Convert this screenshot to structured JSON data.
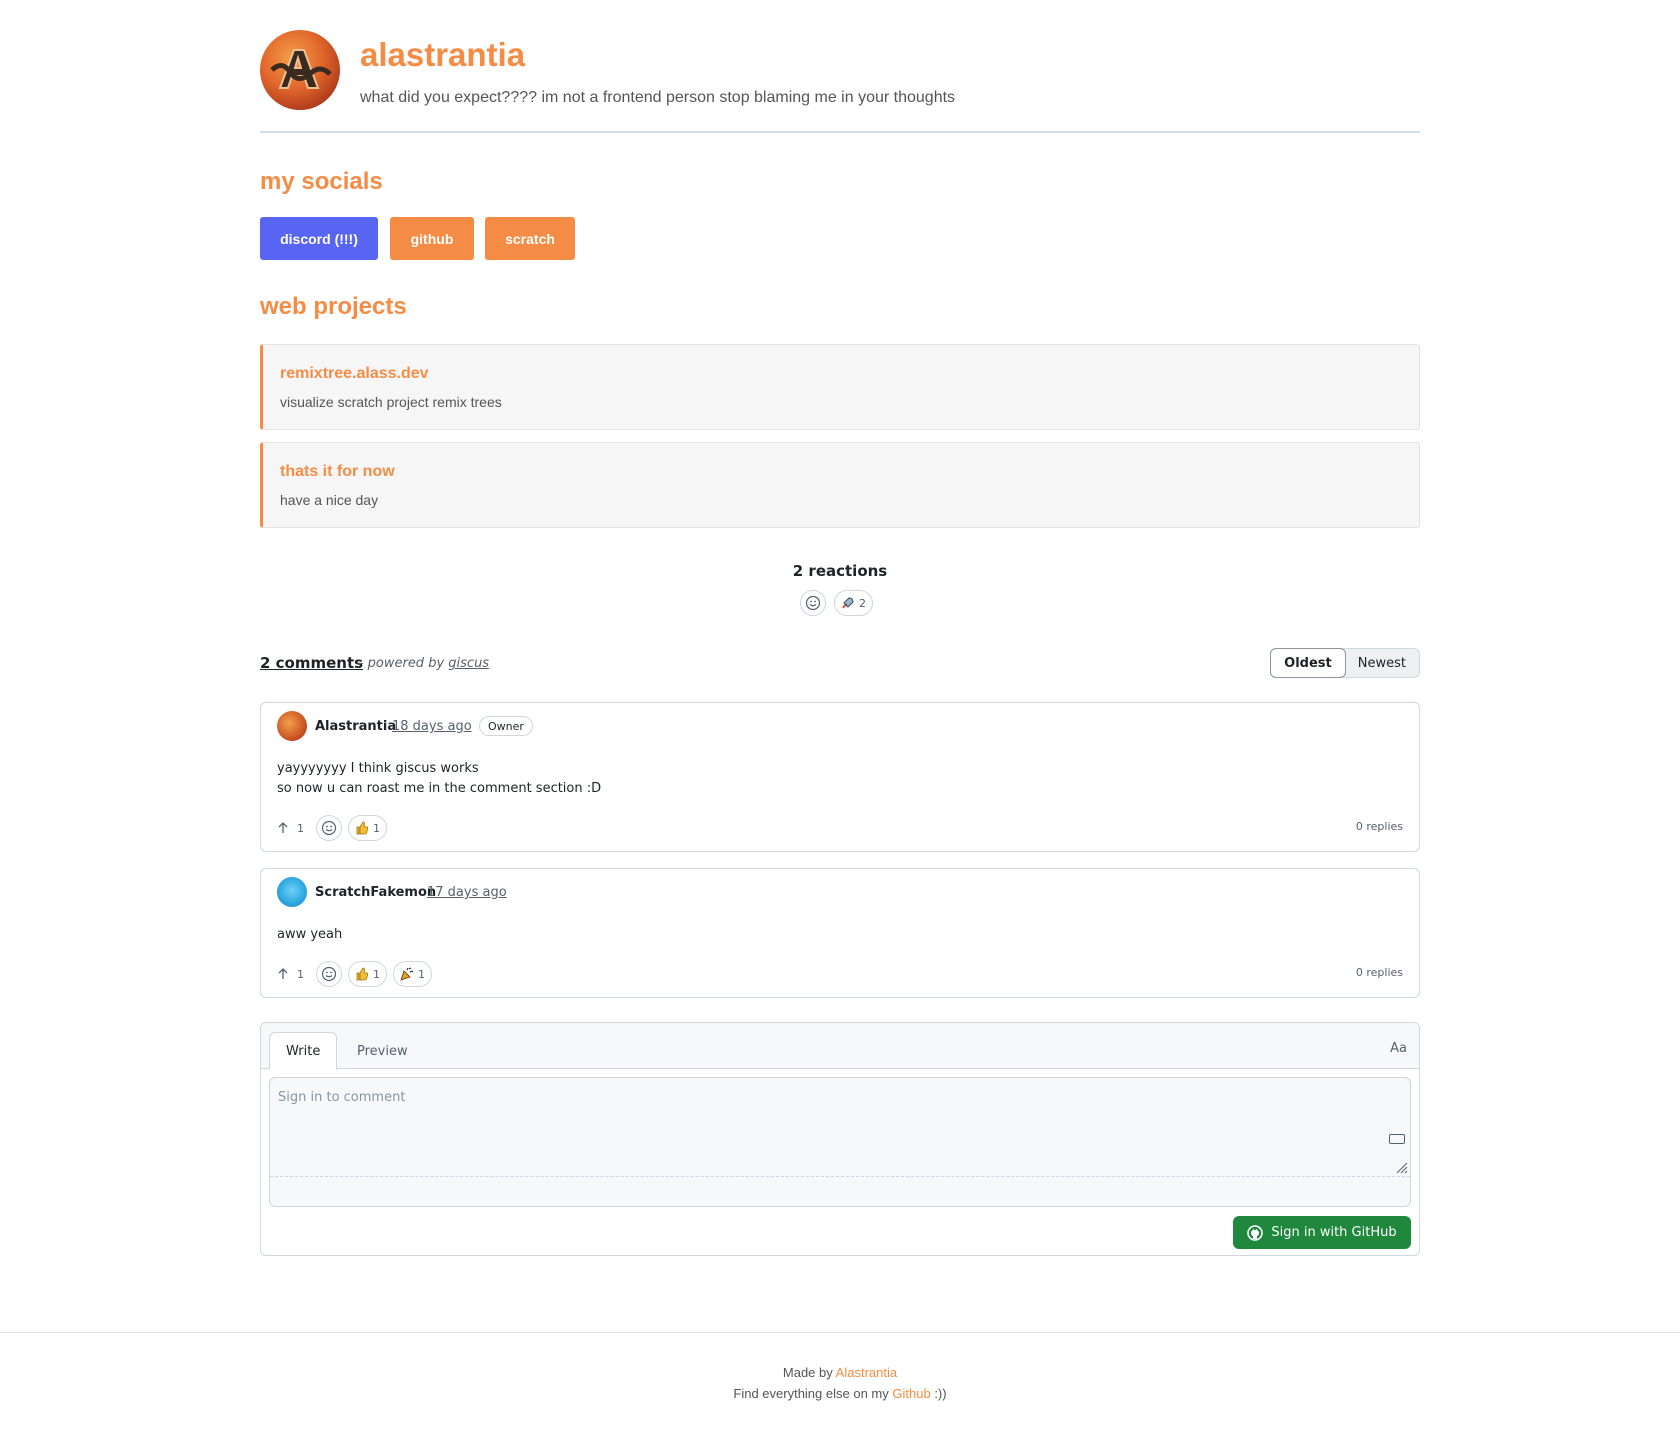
{
  "profile": {
    "name": "alastrantia",
    "tagline": "what did you expect???? im not a frontend person stop blaming me in your thoughts"
  },
  "socials": {
    "heading": "my socials",
    "buttons": [
      "discord (!!!)",
      "github",
      "scratch"
    ],
    "discord_color": "#5865f2",
    "accent_color": "#f58c45"
  },
  "projects": {
    "heading": "web projects",
    "items": [
      {
        "title": "remixtree.alass.dev",
        "desc": "visualize scratch project remix trees"
      },
      {
        "title": "thats it for now",
        "desc": "have a nice day"
      }
    ]
  },
  "giscus": {
    "reactions_title": "2 reactions",
    "rocket_count": "2",
    "comments_count": "2 comments",
    "powered_prefix": "– powered by",
    "powered_link": "giscus",
    "sort": [
      "Oldest",
      "Newest"
    ],
    "comments": [
      {
        "author": "Alastrantia",
        "time": "18 days ago",
        "badge": "Owner",
        "lines": [
          "yayyyyyyy I think giscus works",
          "so now u can roast me in the comment section :D"
        ],
        "upvotes": "1",
        "thumbs": "1",
        "replies": "0 replies"
      },
      {
        "author": "ScratchFakemon",
        "time": "17 days ago",
        "lines": [
          "aww yeah"
        ],
        "upvotes": "1",
        "thumbs": "1",
        "other": "1",
        "replies": "0 replies"
      }
    ],
    "editor": {
      "tab_write": "Write",
      "tab_preview": "Preview",
      "aa": "Aa",
      "placeholder": "Sign in to comment",
      "signin": "Sign in with GitHub",
      "signin_color": "#1f883d"
    }
  },
  "footer": {
    "made_by": "Made by",
    "made_by_link": "Alastrantia",
    "find": "Find everything else on my",
    "find_link": "Github",
    "find_suffix": ":))"
  }
}
